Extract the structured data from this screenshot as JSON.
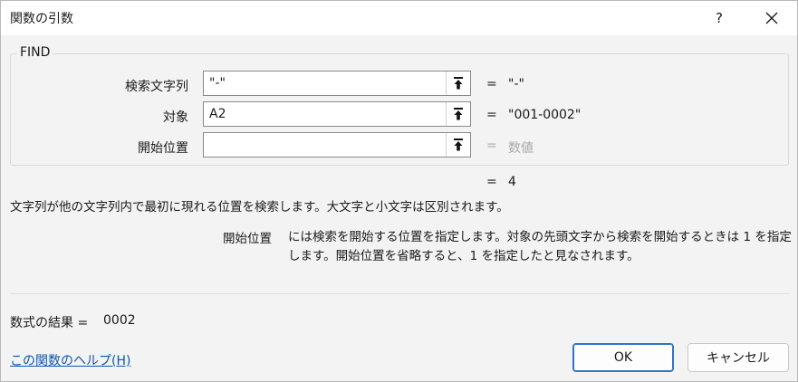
{
  "window": {
    "title": "関数の引数",
    "help_label": "?"
  },
  "function": {
    "name": "FIND"
  },
  "arguments": [
    {
      "label": "検索文字列",
      "value": "\"-\"",
      "result": "\"-\""
    },
    {
      "label": "対象",
      "value": "A2",
      "result": "\"001-0002\""
    },
    {
      "label": "開始位置",
      "value": "",
      "result": "数値"
    }
  ],
  "equals_sign": "=",
  "function_result": "4",
  "description": "文字列が他の文字列内で最初に現れる位置を検索します。大文字と小文字は区別されます。",
  "argument_help": {
    "name": "開始位置",
    "text": "には検索を開始する位置を指定します。対象の先頭文字から検索を開始するときは 1 を指定します。開始位置を省略すると、1 を指定したと見なされます。"
  },
  "formula_result": {
    "label": "数式の結果 =",
    "value": "0002"
  },
  "footer": {
    "help_link": "この関数のヘルプ(H)",
    "ok_label": "OK",
    "cancel_label": "キャンセル"
  },
  "colors": {
    "link": "#0b57b0",
    "default_button_border": "#2f74c8",
    "placeholder": "#a8a8a8"
  },
  "icons": {
    "collapse": "collapse-dialog-arrow-icon",
    "close": "close-icon"
  }
}
